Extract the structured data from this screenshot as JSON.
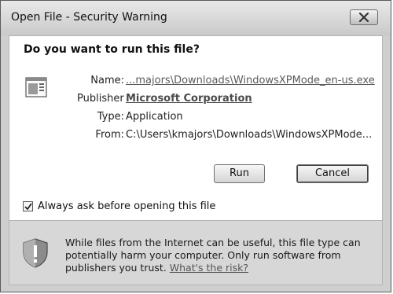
{
  "window": {
    "title": "Open File - Security Warning",
    "close_icon": "close-icon"
  },
  "dialog": {
    "question": "Do you want to run this file?",
    "file_icon": "executable-file-icon",
    "fields": [
      {
        "label": "Name:",
        "value": "...majors\\Downloads\\WindowsXPMode_en-us.exe"
      },
      {
        "label": "Publisher:",
        "value": "Microsoft Corporation"
      },
      {
        "label": "Type:",
        "value": "Application"
      },
      {
        "label": "From:",
        "value": "C:\\Users\\kmajors\\Downloads\\WindowsXPMode..."
      }
    ],
    "buttons": {
      "run": "Run",
      "cancel": "Cancel"
    },
    "always_ask": {
      "label": "Always ask before opening this file",
      "checked": true
    }
  },
  "warning": {
    "icon": "shield-warning-icon",
    "text": "While files from the Internet can be useful, this file type can potentially harm your computer. Only run software from publishers you trust.",
    "link": "What's the risk?"
  }
}
